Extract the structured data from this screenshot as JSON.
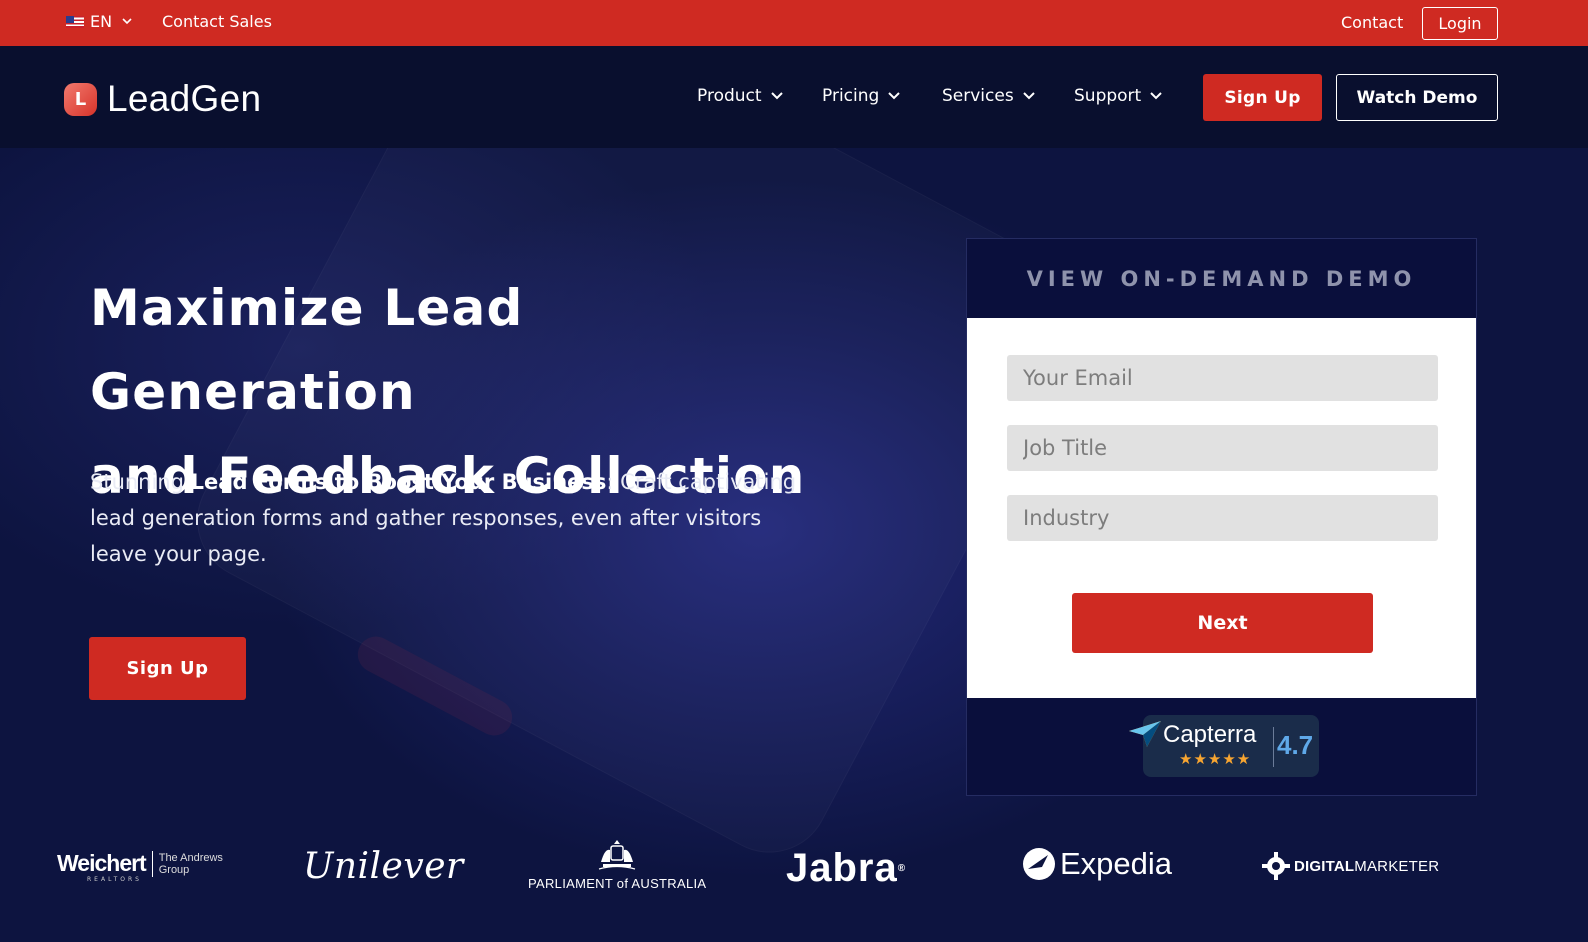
{
  "topbar": {
    "language": "EN",
    "contact_sales": "Contact Sales",
    "contact": "Contact",
    "login": "Login"
  },
  "nav": {
    "logo_text": "LeadGen",
    "logo_letter": "L",
    "items": [
      {
        "label": "Product"
      },
      {
        "label": "Pricing"
      },
      {
        "label": "Services"
      },
      {
        "label": "Support"
      }
    ],
    "signup": "Sign Up",
    "watch_demo": "Watch Demo"
  },
  "hero": {
    "title_line1": "Maximize Lead Generation",
    "title_line2": "and Feedback Collection",
    "desc_prefix": "Stunning ",
    "desc_bold": "Lead Forms to Boost Your Business",
    "desc_suffix": ": Craft captivating lead generation forms and gather responses, even after visitors leave your page.",
    "signup": "Sign Up"
  },
  "demo_form": {
    "header": "VIEW ON-DEMAND DEMO",
    "email_placeholder": "Your Email",
    "job_title_placeholder": "Job Title",
    "industry_placeholder": "Industry",
    "next": "Next",
    "capterra_name": "Capterra",
    "capterra_stars": "★★★★★",
    "capterra_rating": "4.7"
  },
  "logos": {
    "weichert_main": "Weichert",
    "weichert_sub": "REALTORS",
    "weichert_group_line1": "The Andrews",
    "weichert_group_line2": "Group",
    "unilever": "Unilever",
    "parliament": "PARLIAMENT of AUSTRALIA",
    "jabra": "Jabra",
    "expedia": "Expedia",
    "digital_marketer_bold": "DIGITAL",
    "digital_marketer_rest": "MARKETER"
  },
  "colors": {
    "brand_red": "#cf2a22",
    "nav_bg": "#090f2e",
    "hero_bg": "#0d1440",
    "capterra_blue": "#5fa8e8",
    "star_orange": "#f7a531"
  }
}
